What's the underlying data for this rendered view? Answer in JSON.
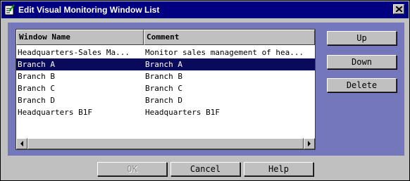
{
  "window": {
    "title": "Edit Visual Monitoring Window List"
  },
  "list": {
    "columns": [
      "Window Name",
      "Comment"
    ],
    "rows": [
      {
        "name": "Headquarters-Sales Ma...",
        "comment": "Monitor sales management of hea..."
      },
      {
        "name": "Branch A",
        "comment": "Branch A",
        "selected": true
      },
      {
        "name": "Branch B",
        "comment": "Branch B"
      },
      {
        "name": "Branch C",
        "comment": "Branch C"
      },
      {
        "name": "Branch D",
        "comment": "Branch D"
      },
      {
        "name": "Headquarters B1F",
        "comment": "Headquarters B1F"
      }
    ]
  },
  "buttons": {
    "up": "Up",
    "down": "Down",
    "delete": "Delete",
    "ok": "OK",
    "cancel": "Cancel",
    "help": "Help"
  },
  "colors": {
    "titlebar": "#000080",
    "panel": "#7577bd",
    "selection": "#0a0a5c"
  }
}
